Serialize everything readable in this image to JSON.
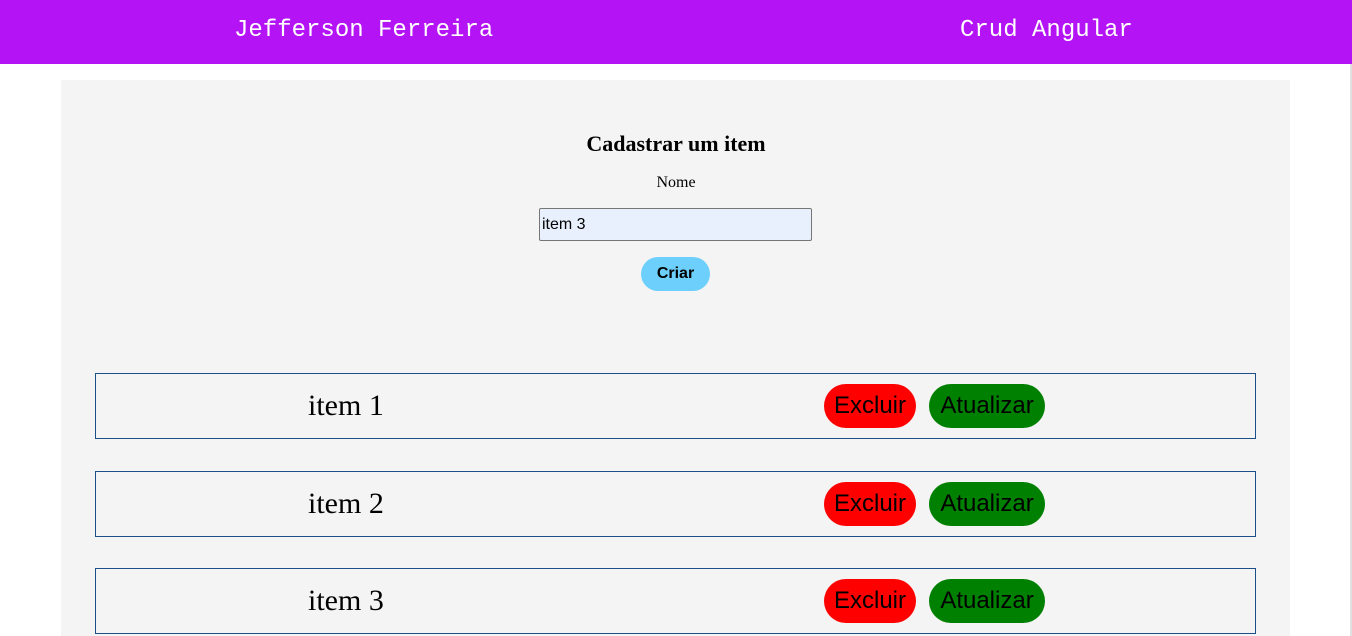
{
  "header": {
    "author": "Jefferson Ferreira",
    "app_title": "Crud Angular"
  },
  "form": {
    "title": "Cadastrar um item",
    "name_label": "Nome",
    "name_value": "item 3",
    "create_label": "Criar"
  },
  "items": [
    {
      "name": "item 1",
      "delete_label": "Excluir",
      "update_label": "Atualizar"
    },
    {
      "name": "item 2",
      "delete_label": "Excluir",
      "update_label": "Atualizar"
    },
    {
      "name": "item 3",
      "delete_label": "Excluir",
      "update_label": "Atualizar"
    }
  ],
  "colors": {
    "header_bg": "#b313f5",
    "create_button": "#6dcffb",
    "delete_button": "#ff0000",
    "update_button": "#008000",
    "item_border": "#1a4f8a",
    "panel_bg": "#f4f4f4"
  }
}
